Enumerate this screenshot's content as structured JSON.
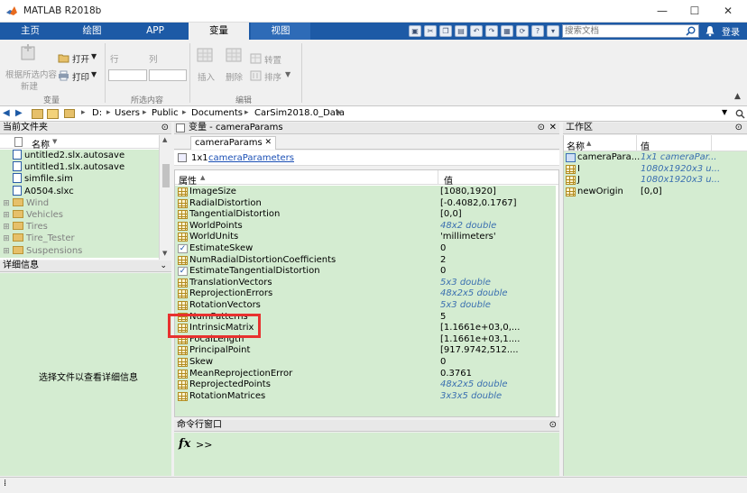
{
  "window": {
    "title": "MATLAB R2018b",
    "minimize": "—",
    "maximize": "☐",
    "close": "✕"
  },
  "ribbon_tabs": [
    "主页",
    "绘图",
    "APP",
    "变量",
    "视图"
  ],
  "search": {
    "placeholder": "搜索文档"
  },
  "login_label": "登录",
  "ribbon": {
    "new_from_selection": "根据所选内容",
    "new_label": "新建",
    "open_label": "打开",
    "print_label": "打印",
    "row_label": "行",
    "col_label": "列",
    "insert_label": "插入",
    "delete_label": "删除",
    "transpose_label": "转置",
    "sort_label": "排序",
    "sections": [
      "变量",
      "所选内容",
      "编辑"
    ]
  },
  "address": {
    "crumbs": [
      "D:",
      "Users",
      "Public",
      "Documents",
      "CarSim2018.0_Data"
    ]
  },
  "current_folder": {
    "title": "当前文件夹",
    "name_header": "名称",
    "files": [
      {
        "name": "untitled2.slx.autosave",
        "kind": "file"
      },
      {
        "name": "untitled1.slx.autosave",
        "kind": "file"
      },
      {
        "name": "simfile.sim",
        "kind": "file"
      },
      {
        "name": "A0504.slxc",
        "kind": "file"
      },
      {
        "name": "Wind",
        "kind": "folder"
      },
      {
        "name": "Vehicles",
        "kind": "folder"
      },
      {
        "name": "Tires",
        "kind": "folder"
      },
      {
        "name": "Tire_Tester",
        "kind": "folder"
      },
      {
        "name": "Suspensions",
        "kind": "folder"
      }
    ]
  },
  "details": {
    "title": "详细信息",
    "empty_text": "选择文件以查看详细信息"
  },
  "variable_editor": {
    "title": "变量 - cameraParams",
    "tab": "cameraParams",
    "size_text": "1x1",
    "class_link": "cameraParameters",
    "col_property": "属性",
    "col_value": "值",
    "rows": [
      {
        "name": "ImageSize",
        "value": "[1080,1920]",
        "icon": "grid",
        "italic": false
      },
      {
        "name": "RadialDistortion",
        "value": "[-0.4082,0.1767]",
        "icon": "grid",
        "italic": false
      },
      {
        "name": "TangentialDistortion",
        "value": "[0,0]",
        "icon": "grid",
        "italic": false
      },
      {
        "name": "WorldPoints",
        "value": "48x2 double",
        "icon": "grid",
        "italic": true
      },
      {
        "name": "WorldUnits",
        "value": "'millimeters'",
        "icon": "grid",
        "italic": false
      },
      {
        "name": "EstimateSkew",
        "value": "0",
        "icon": "check",
        "italic": false
      },
      {
        "name": "NumRadialDistortionCoefficients",
        "value": "2",
        "icon": "grid",
        "italic": false
      },
      {
        "name": "EstimateTangentialDistortion",
        "value": "0",
        "icon": "check",
        "italic": false
      },
      {
        "name": "TranslationVectors",
        "value": "5x3 double",
        "icon": "grid",
        "italic": true
      },
      {
        "name": "ReprojectionErrors",
        "value": "48x2x5 double",
        "icon": "grid",
        "italic": true
      },
      {
        "name": "RotationVectors",
        "value": "5x3 double",
        "icon": "grid",
        "italic": true
      },
      {
        "name": "NumPatterns",
        "value": "5",
        "icon": "grid",
        "italic": false
      },
      {
        "name": "IntrinsicMatrix",
        "value": "[1.1661e+03,0,...",
        "icon": "grid",
        "italic": false
      },
      {
        "name": "FocalLength",
        "value": "[1.1661e+03,1....",
        "icon": "grid",
        "italic": false
      },
      {
        "name": "PrincipalPoint",
        "value": "[917.9742,512....",
        "icon": "grid",
        "italic": false
      },
      {
        "name": "Skew",
        "value": "0",
        "icon": "grid",
        "italic": false
      },
      {
        "name": "MeanReprojectionError",
        "value": "0.3761",
        "icon": "grid",
        "italic": false
      },
      {
        "name": "ReprojectedPoints",
        "value": "48x2x5 double",
        "icon": "grid",
        "italic": true
      },
      {
        "name": "RotationMatrices",
        "value": "3x3x5 double",
        "icon": "grid",
        "italic": true
      }
    ],
    "highlight_color": "#e8312f"
  },
  "command_window": {
    "title": "命令行窗口",
    "fx": "fx",
    "prompt": ">>"
  },
  "workspace": {
    "title": "工作区",
    "col_name": "名称",
    "col_value": "值",
    "rows": [
      {
        "name": "cameraPara...",
        "value": "1x1 cameraPar...",
        "italic": true
      },
      {
        "name": "I",
        "value": "1080x1920x3 u...",
        "italic": true
      },
      {
        "name": "J",
        "value": "1080x1920x3 u...",
        "italic": true
      },
      {
        "name": "newOrigin",
        "value": "[0,0]",
        "italic": false
      }
    ]
  },
  "status_bar": {
    "mode": ""
  }
}
